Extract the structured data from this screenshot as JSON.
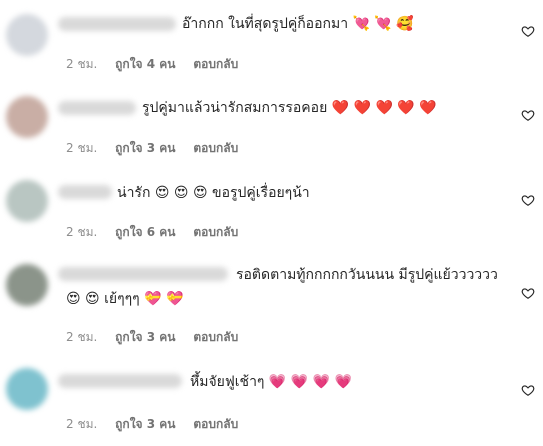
{
  "comments": [
    {
      "text_line1": "อ๊ากกก ในที่สุดรูปคู่ก็ออกมา 💘 💘 🥰",
      "text_line2": "",
      "time": "2 ชม.",
      "likes": "ถูกใจ 4 คน",
      "reply": "ตอบกลับ",
      "avatar_color": "#d4d8de"
    },
    {
      "text_line1": "รูปคู่มาแล้วน่ารักสมการรอคอย ❤️ ❤️ ❤️ ❤️ ❤️",
      "text_line2": "",
      "time": "2 ชม.",
      "likes": "ถูกใจ 3 คน",
      "reply": "ตอบกลับ",
      "avatar_color": "#c9aea5"
    },
    {
      "text_line1": "น่ารัก 😍 😍 😍 ขอรูปคู่เรื่อยๆน้า",
      "text_line2": "",
      "time": "2 ชม.",
      "likes": "ถูกใจ 6 คน",
      "reply": "ตอบกลับ",
      "avatar_color": "#b9c6c2"
    },
    {
      "text_line1": "รอติดตามทู้กกกกกวันนนน มีรูปคู่แย้วววววว",
      "text_line2": "😍 😍 เย้ๆๆๆ 💝 💝",
      "time": "2 ชม.",
      "likes": "ถูกใจ 3 คน",
      "reply": "ตอบกลับ",
      "avatar_color": "#8b948a"
    },
    {
      "text_line1": "หึ้มจัยฟูเช้าๆ 💗 💗 💗 💗",
      "text_line2": "",
      "time": "2 ชม.",
      "likes": "ถูกใจ 3 คน",
      "reply": "ตอบกลับ",
      "avatar_color": "#7fc2cf"
    }
  ]
}
